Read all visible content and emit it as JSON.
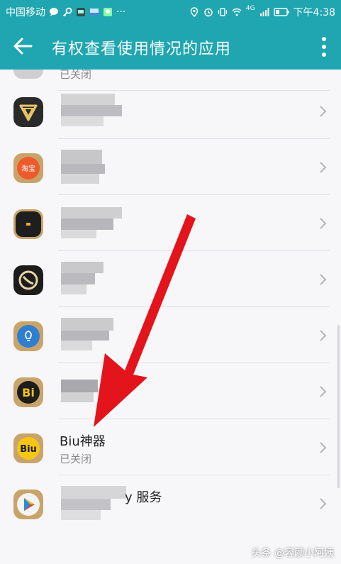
{
  "status_bar": {
    "carrier": "中国移动",
    "time": "下午4:38",
    "dots": "···",
    "network": "4G"
  },
  "app_bar": {
    "title": "有权查看使用情况的应用"
  },
  "list": {
    "top_partial_subtitle": "已关闭",
    "items": [
      {
        "icon": "shield-app-icon",
        "title": "",
        "subtitle": ""
      },
      {
        "icon": "orange-app-icon",
        "title": "",
        "subtitle": "",
        "icon_text": "淘宝"
      },
      {
        "icon": "dark-app-icon",
        "title": "",
        "subtitle": ""
      },
      {
        "icon": "circle-app-icon",
        "title": "",
        "subtitle": ""
      },
      {
        "icon": "bulb-app-icon",
        "title": "",
        "subtitle": ""
      },
      {
        "icon": "bi-app-icon",
        "title": "",
        "subtitle": "",
        "icon_text": "Bi"
      },
      {
        "icon": "biu-app-icon",
        "title": "Biu神器",
        "subtitle": "已关闭",
        "icon_text": "Biu"
      },
      {
        "icon": "play-app-icon",
        "title": "y 服务",
        "subtitle": ""
      }
    ]
  },
  "watermark": "头条 @容颜小阿姨",
  "colors": {
    "accent": "#1fa6b0",
    "arrow": "#e3141b",
    "background": "#f7f7f9"
  }
}
